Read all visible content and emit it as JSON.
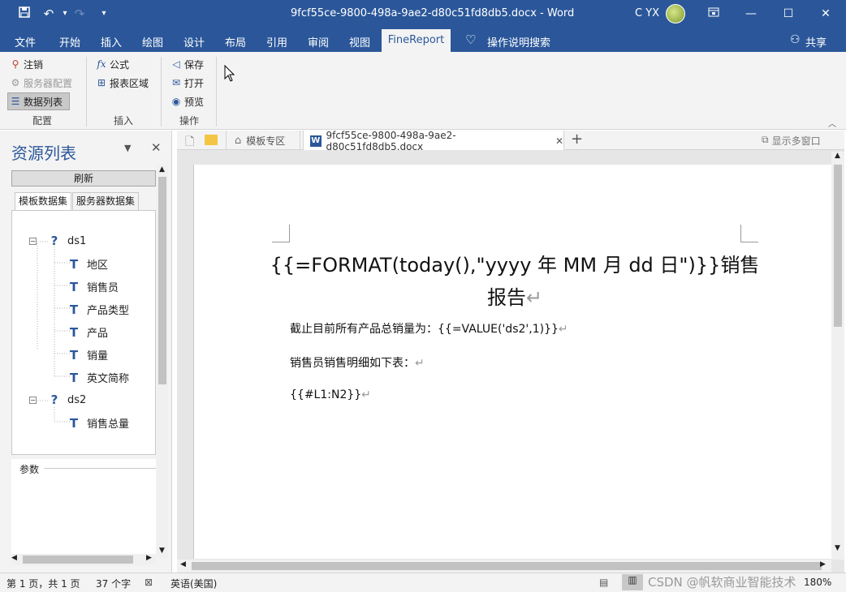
{
  "window": {
    "title": "9fcf55ce-9800-498a-9ae2-d80c51fd8db5.docx - Word",
    "user": "C YX"
  },
  "menu": [
    "文件",
    "开始",
    "插入",
    "绘图",
    "设计",
    "布局",
    "引用",
    "审阅",
    "视图",
    "FineReport",
    "操作说明搜索",
    "共享"
  ],
  "ribbon": {
    "btn_logout": "注销",
    "btn_server_config": "服务器配置",
    "btn_data_list": "数据列表",
    "grp_config": "配置",
    "btn_formula": "公式",
    "btn_report_area": "报表区域",
    "grp_insert": "插入",
    "btn_save": "保存",
    "btn_open": "打开",
    "btn_preview": "预览",
    "grp_operation": "操作"
  },
  "pane": {
    "title": "资源列表",
    "refresh": "刷新",
    "tab_template": "模板数据集",
    "tab_server": "服务器数据集",
    "params": "参数",
    "ds1": "ds1",
    "ds1_fields": [
      "地区",
      "销售员",
      "产品类型",
      "产品",
      "销量",
      "英文简称"
    ],
    "ds2": "ds2",
    "ds2_fields": [
      "销售总量"
    ]
  },
  "doctabs": {
    "template_zone": "模板专区",
    "file": "9fcf55ce-9800-498a-9ae2-d80c51fd8db5.docx",
    "multi_window": "显示多窗口"
  },
  "doc": {
    "title_line1": "{{=FORMAT(today(),\"yyyy 年 MM 月 dd 日\")}}销售",
    "title_line2": "报告",
    "para1": "截止目前所有产品总销量为：{{=VALUE('ds2',1)}}",
    "para2": "销售员销售明细如下表：",
    "para3": "{{#L1:N2}}",
    "return_mark": "↵"
  },
  "status": {
    "page": "第 1 页，共 1 页",
    "words": "37 个字",
    "lang": "英语(美国)",
    "zoom": "180%",
    "watermark": "CSDN @帆软商业智能技术"
  },
  "colors": {
    "accent": "#2b579a",
    "ribbon_bg": "#f3f3f3"
  }
}
